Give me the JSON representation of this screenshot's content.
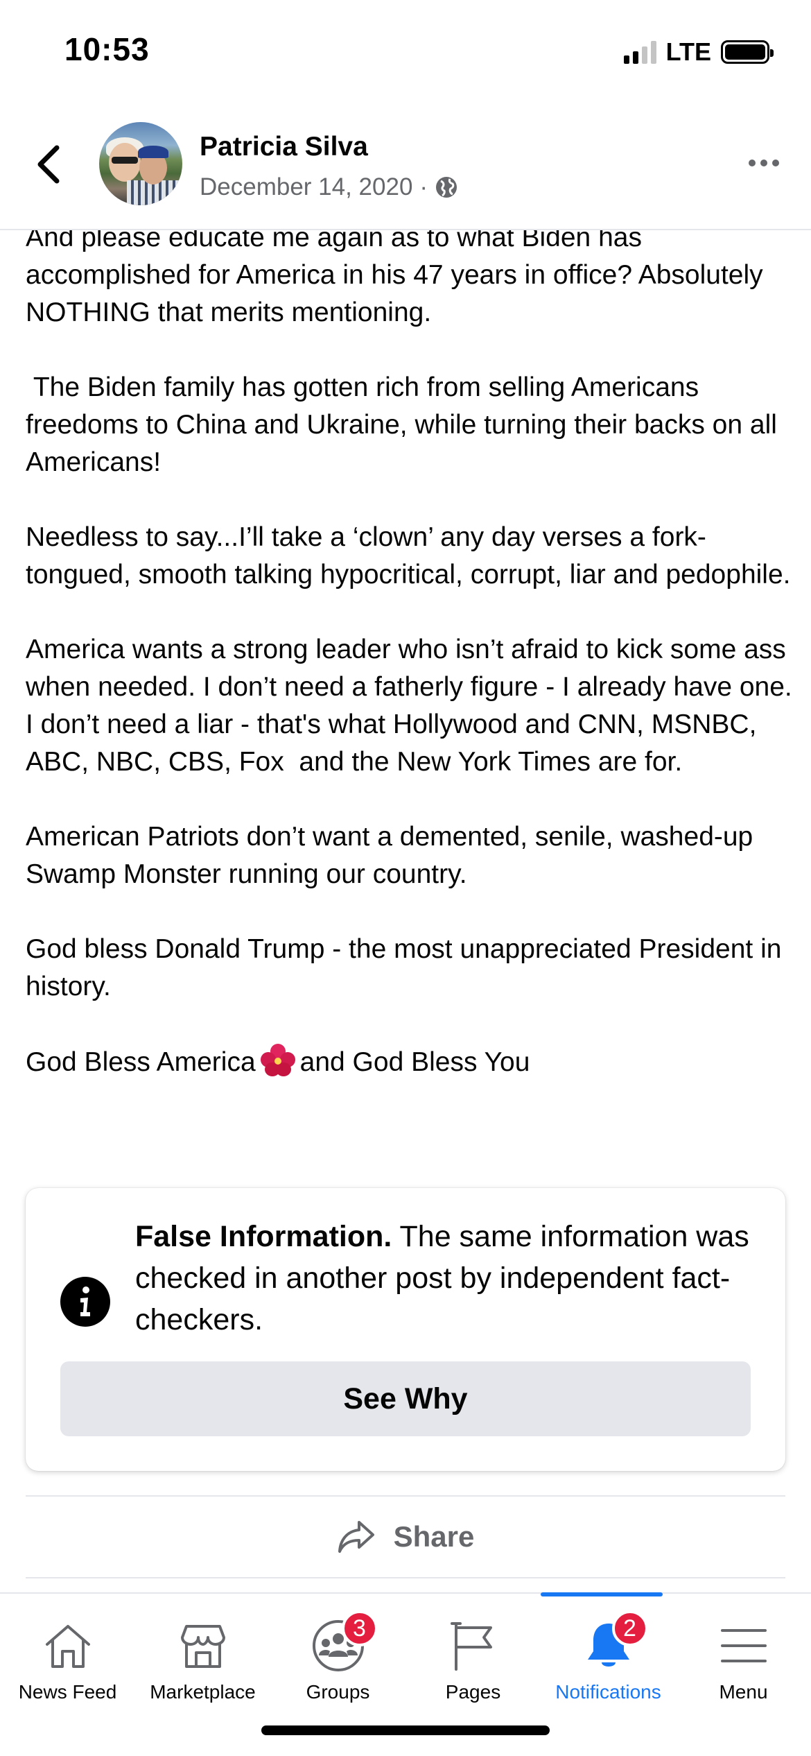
{
  "status_bar": {
    "time": "10:53",
    "network": "LTE"
  },
  "post": {
    "author": "Patricia Silva",
    "date": "December 14, 2020",
    "separator": "·",
    "privacy_icon": "globe-icon",
    "paragraphs": [
      "And please educate me again as to what Biden has accomplished for America in his 47 years in office? Absolutely NOTHING that merits mentioning.",
      " The Biden family has gotten rich from selling Americans freedoms to China and Ukraine, while turning their backs on all Americans!",
      "Needless to say...I’ll take a ‘clown’ any day verses a fork-tongued, smooth talking hypocritical, corrupt, liar and pedophile.",
      "America wants a strong leader who isn’t afraid to kick some ass when needed. I don’t need a fatherly figure - I already have one. I don’t need a liar - that's what Hollywood and CNN, MSNBC, ABC, NBC, CBS, Fox  and the New York Times are for.",
      "American Patriots don’t want a demented, senile, washed-up Swamp Monster running our country.",
      "God bless Donald Trump - the most unappreciated President in history."
    ],
    "closing_before": "God Bless America",
    "closing_emoji": "hibiscus-emoji",
    "closing_after": "and God Bless You"
  },
  "fact_check": {
    "title": "False Information.",
    "message": " The same information was checked in another post by independent fact-checkers.",
    "button_label": "See Why"
  },
  "actions": {
    "share_label": "Share"
  },
  "tab_bar": {
    "active_color": "#1877f2",
    "badge_color": "#e41e3f",
    "tabs": [
      {
        "label": "News Feed",
        "icon": "home-icon"
      },
      {
        "label": "Marketplace",
        "icon": "shop-icon"
      },
      {
        "label": "Groups",
        "icon": "groups-icon",
        "badge": "3"
      },
      {
        "label": "Pages",
        "icon": "flag-icon"
      },
      {
        "label": "Notifications",
        "icon": "bell-icon",
        "badge": "2",
        "active": true
      },
      {
        "label": "Menu",
        "icon": "hamburger-icon"
      }
    ]
  }
}
